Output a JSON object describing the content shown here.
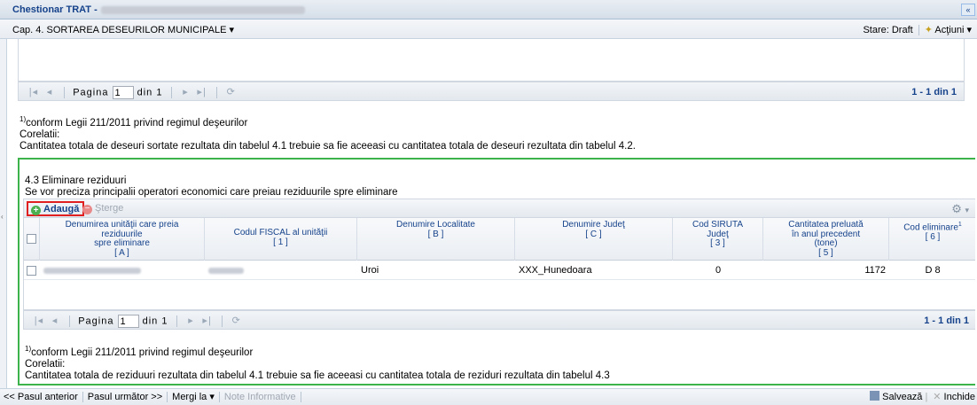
{
  "window": {
    "title": "Chestionar TRAT -"
  },
  "menubar": {
    "chapter": "Cap. 4. SORTAREA DESEURILOR MUNICIPALE",
    "chevron": "▾",
    "status": "Stare: Draft",
    "actions": "Acţiuni"
  },
  "pager1": {
    "page_label": "Pagina",
    "page_value": "1",
    "of_label": "din 1",
    "count": "1 - 1 din 1"
  },
  "note1": {
    "footnote": "conform Legii 211/2011 privind regimul deşeurilor",
    "corelatii": "Corelatii:",
    "text": "Cantitatea totala de deseuri sortate rezultata din tabelul 4.1 trebuie sa fie aceeasi cu cantitatea totala de deseuri rezultata din tabelul 4.2."
  },
  "section": {
    "title": "4.3 Eliminare reziduuri",
    "subtitle": "Se vor preciza principalii operatori economici care preiau reziduurile spre eliminare",
    "add_label": "Adaugă",
    "delete_label": "Şterge"
  },
  "table": {
    "columns": [
      {
        "line1": "Denumirea unităţii care preia",
        "line2": "reziduurile",
        "line3": "spre eliminare",
        "code": "[ A ]"
      },
      {
        "line1": "Codul FISCAL al unităţii",
        "line2": "",
        "line3": "",
        "code": "[ 1 ]"
      },
      {
        "line1": "Denumire Localitate",
        "line2": "",
        "line3": "",
        "code": "[ B ]"
      },
      {
        "line1": "Denumire Judeţ",
        "line2": "",
        "line3": "",
        "code": "[ C ]"
      },
      {
        "line1": "Cod SIRUTA",
        "line2": "Judeţ",
        "line3": "",
        "code": "[ 3 ]"
      },
      {
        "line1": "Cantitatea preluată",
        "line2": "în anul precedent",
        "line3": "(tone)",
        "code": "[ 5 ]"
      },
      {
        "line1": "Cod eliminare",
        "line2": "",
        "line3": "",
        "code": "[ 6 ]"
      }
    ],
    "rows": [
      {
        "localitate": "Uroi",
        "judet": "XXX_Hunedoara",
        "siruta": "0",
        "cantitate": "1172",
        "cod": "D 8"
      }
    ]
  },
  "pager2": {
    "page_label": "Pagina",
    "page_value": "1",
    "of_label": "din 1",
    "count": "1 - 1 din 1"
  },
  "note2": {
    "footnote": "conform Legii 211/2011 privind regimul deşeurilor",
    "corelatii": "Corelatii:",
    "text": "Cantitatea totala de reziduuri rezultata din tabelul 4.1 trebuie sa fie aceeasi cu cantitatea totala de reziduri rezultata din tabelul 4.3"
  },
  "bottombar": {
    "prev": "<< Pasul anterior",
    "next": "Pasul următor >>",
    "goto": "Mergi la",
    "notes": "Note Informative",
    "save": "Salvează",
    "close": "Inchide"
  },
  "colors": {
    "accent": "#15428b",
    "highlight_green": "#3cb44b",
    "highlight_red": "#e02020"
  }
}
